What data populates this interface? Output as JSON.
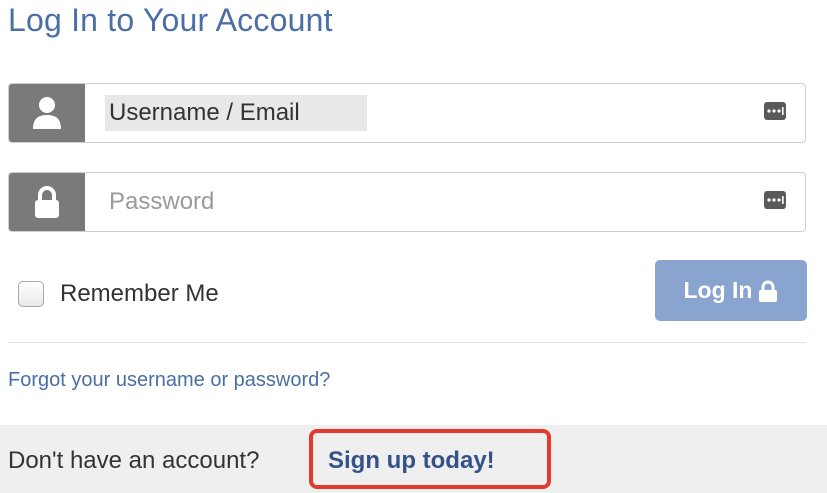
{
  "page": {
    "title": "Log In to Your Account"
  },
  "form": {
    "username": {
      "value": "Username / Email",
      "icon": "user-icon"
    },
    "password": {
      "placeholder": "Password",
      "icon": "lock-icon"
    },
    "remember_label": "Remember Me",
    "login_label": "Log In",
    "forgot_link": "Forgot your username or password?"
  },
  "footer": {
    "prompt": "Don't have an account?",
    "signup_link": "Sign up today!"
  },
  "colors": {
    "title": "#4a6fa5",
    "login_button": "#89a4cf",
    "highlight_box": "#e23b2e",
    "icon_panel": "#7a7a7a"
  }
}
